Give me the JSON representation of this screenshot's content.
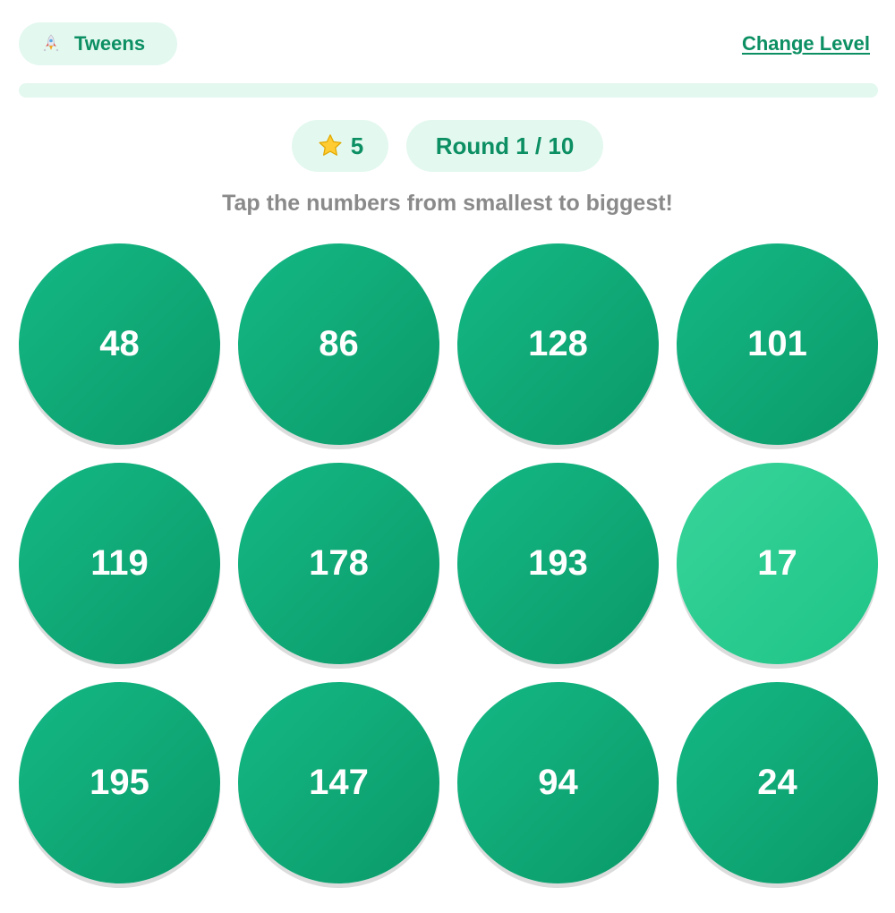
{
  "header": {
    "level_icon": "rocket-icon",
    "level_label": "Tweens",
    "change_level_label": "Change Level"
  },
  "progress": {
    "fraction": 0.0
  },
  "stats": {
    "star_icon": "star-icon",
    "stars": "5",
    "round": "Round 1 / 10"
  },
  "instruction": "Tap the numbers from smallest to biggest!",
  "colors": {
    "accent": "#0c8f63",
    "pill_bg": "#e3f8ef",
    "bubble": "#10a873",
    "bubble_highlight": "#2ccb8f"
  },
  "bubbles": [
    {
      "value": "48",
      "highlighted": false
    },
    {
      "value": "86",
      "highlighted": false
    },
    {
      "value": "128",
      "highlighted": false
    },
    {
      "value": "101",
      "highlighted": false
    },
    {
      "value": "119",
      "highlighted": false
    },
    {
      "value": "178",
      "highlighted": false
    },
    {
      "value": "193",
      "highlighted": false
    },
    {
      "value": "17",
      "highlighted": true
    },
    {
      "value": "195",
      "highlighted": false
    },
    {
      "value": "147",
      "highlighted": false
    },
    {
      "value": "94",
      "highlighted": false
    },
    {
      "value": "24",
      "highlighted": false
    }
  ]
}
